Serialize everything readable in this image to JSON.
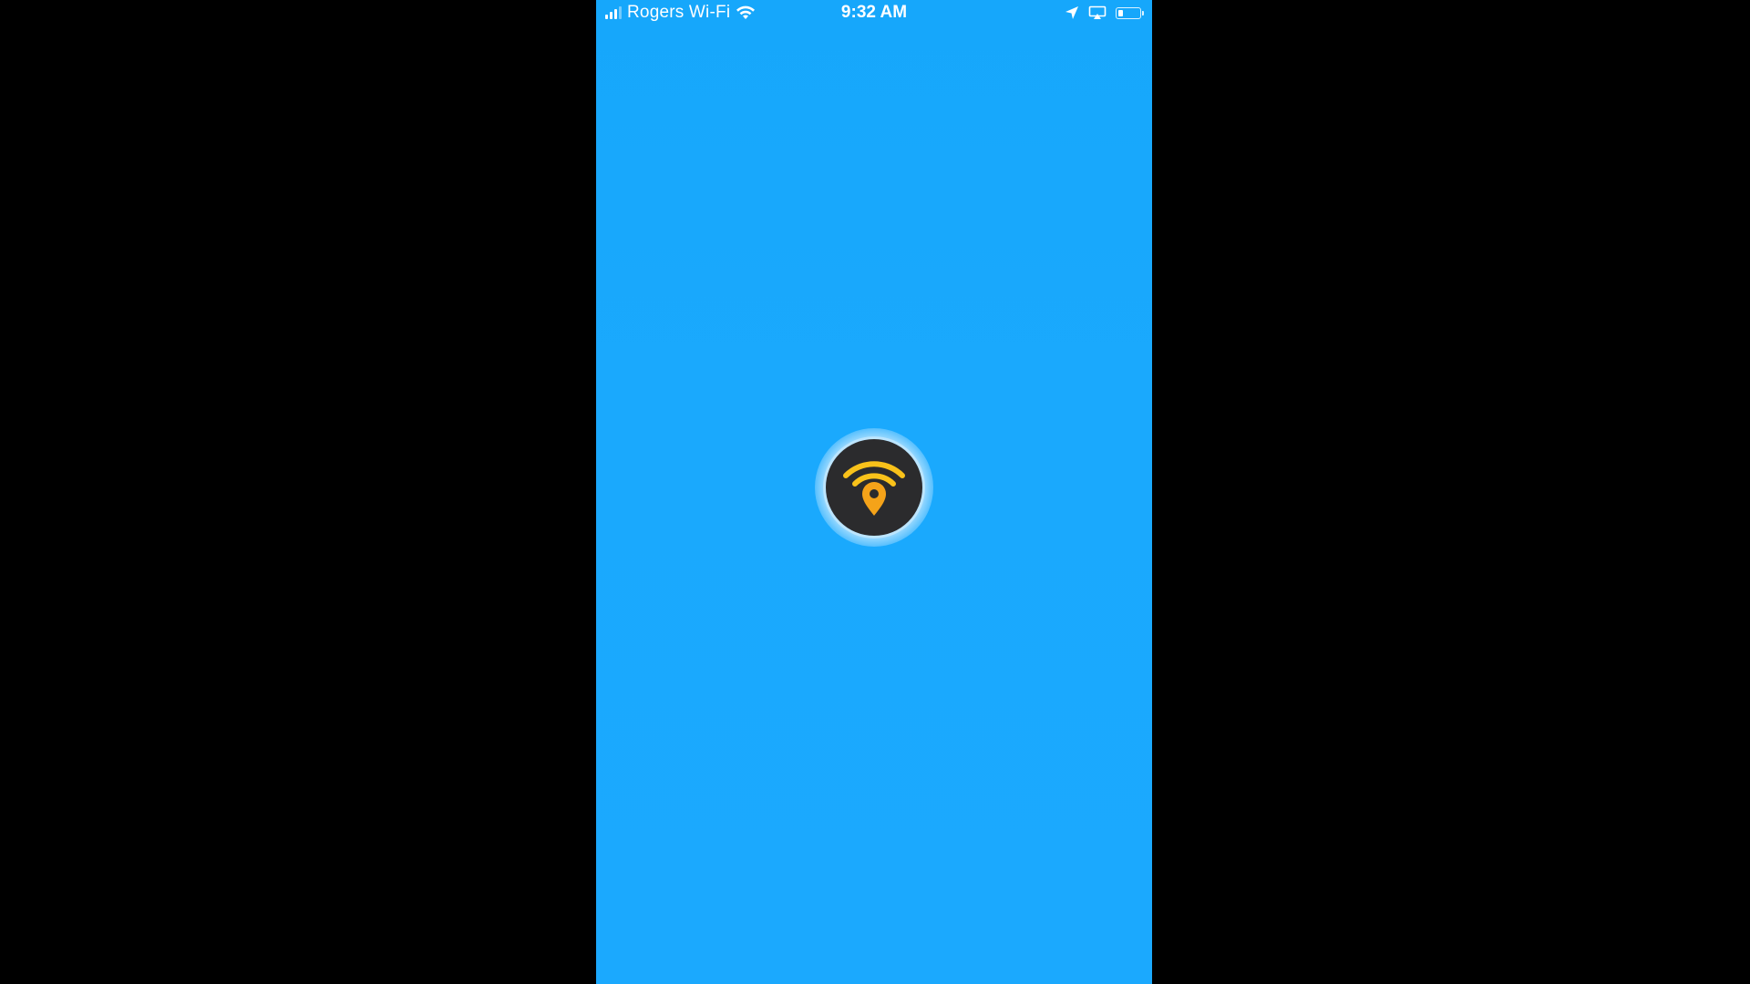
{
  "status_bar": {
    "carrier": "Rogers Wi-Fi",
    "time": "9:32 AM",
    "battery_level": 0.25,
    "icons": [
      "signal-icon",
      "wifi-icon",
      "location-arrow-icon",
      "screen-mirroring-icon",
      "battery-icon"
    ]
  },
  "splash": {
    "logo_icon": "wifi-map-pin-icon"
  },
  "colors": {
    "background_outer": "#000000",
    "screen_background": "#1aa9fd",
    "logo_circle": "#2b2b2d",
    "logo_wifi_arcs": "#f9c21a",
    "logo_pin": "#f5a319"
  }
}
